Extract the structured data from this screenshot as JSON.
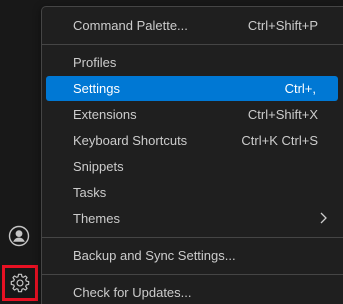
{
  "menu": {
    "items": [
      {
        "label": "Command Palette...",
        "shortcut": "Ctrl+Shift+P"
      },
      {
        "label": "Profiles",
        "shortcut": ""
      },
      {
        "label": "Settings",
        "shortcut": "Ctrl+,"
      },
      {
        "label": "Extensions",
        "shortcut": "Ctrl+Shift+X"
      },
      {
        "label": "Keyboard Shortcuts",
        "shortcut": "Ctrl+K Ctrl+S"
      },
      {
        "label": "Snippets",
        "shortcut": ""
      },
      {
        "label": "Tasks",
        "shortcut": ""
      },
      {
        "label": "Themes",
        "shortcut": ""
      },
      {
        "label": "Backup and Sync Settings...",
        "shortcut": ""
      },
      {
        "label": "Check for Updates...",
        "shortcut": ""
      }
    ],
    "selected_item": "Settings"
  },
  "activity_bar": {
    "icons": [
      "account-icon",
      "gear-icon"
    ]
  },
  "colors": {
    "background": "#181818",
    "menu_background": "#1f1f1f",
    "selection": "#0078d4",
    "text": "#cccccc",
    "highlight_border": "#e81123"
  }
}
